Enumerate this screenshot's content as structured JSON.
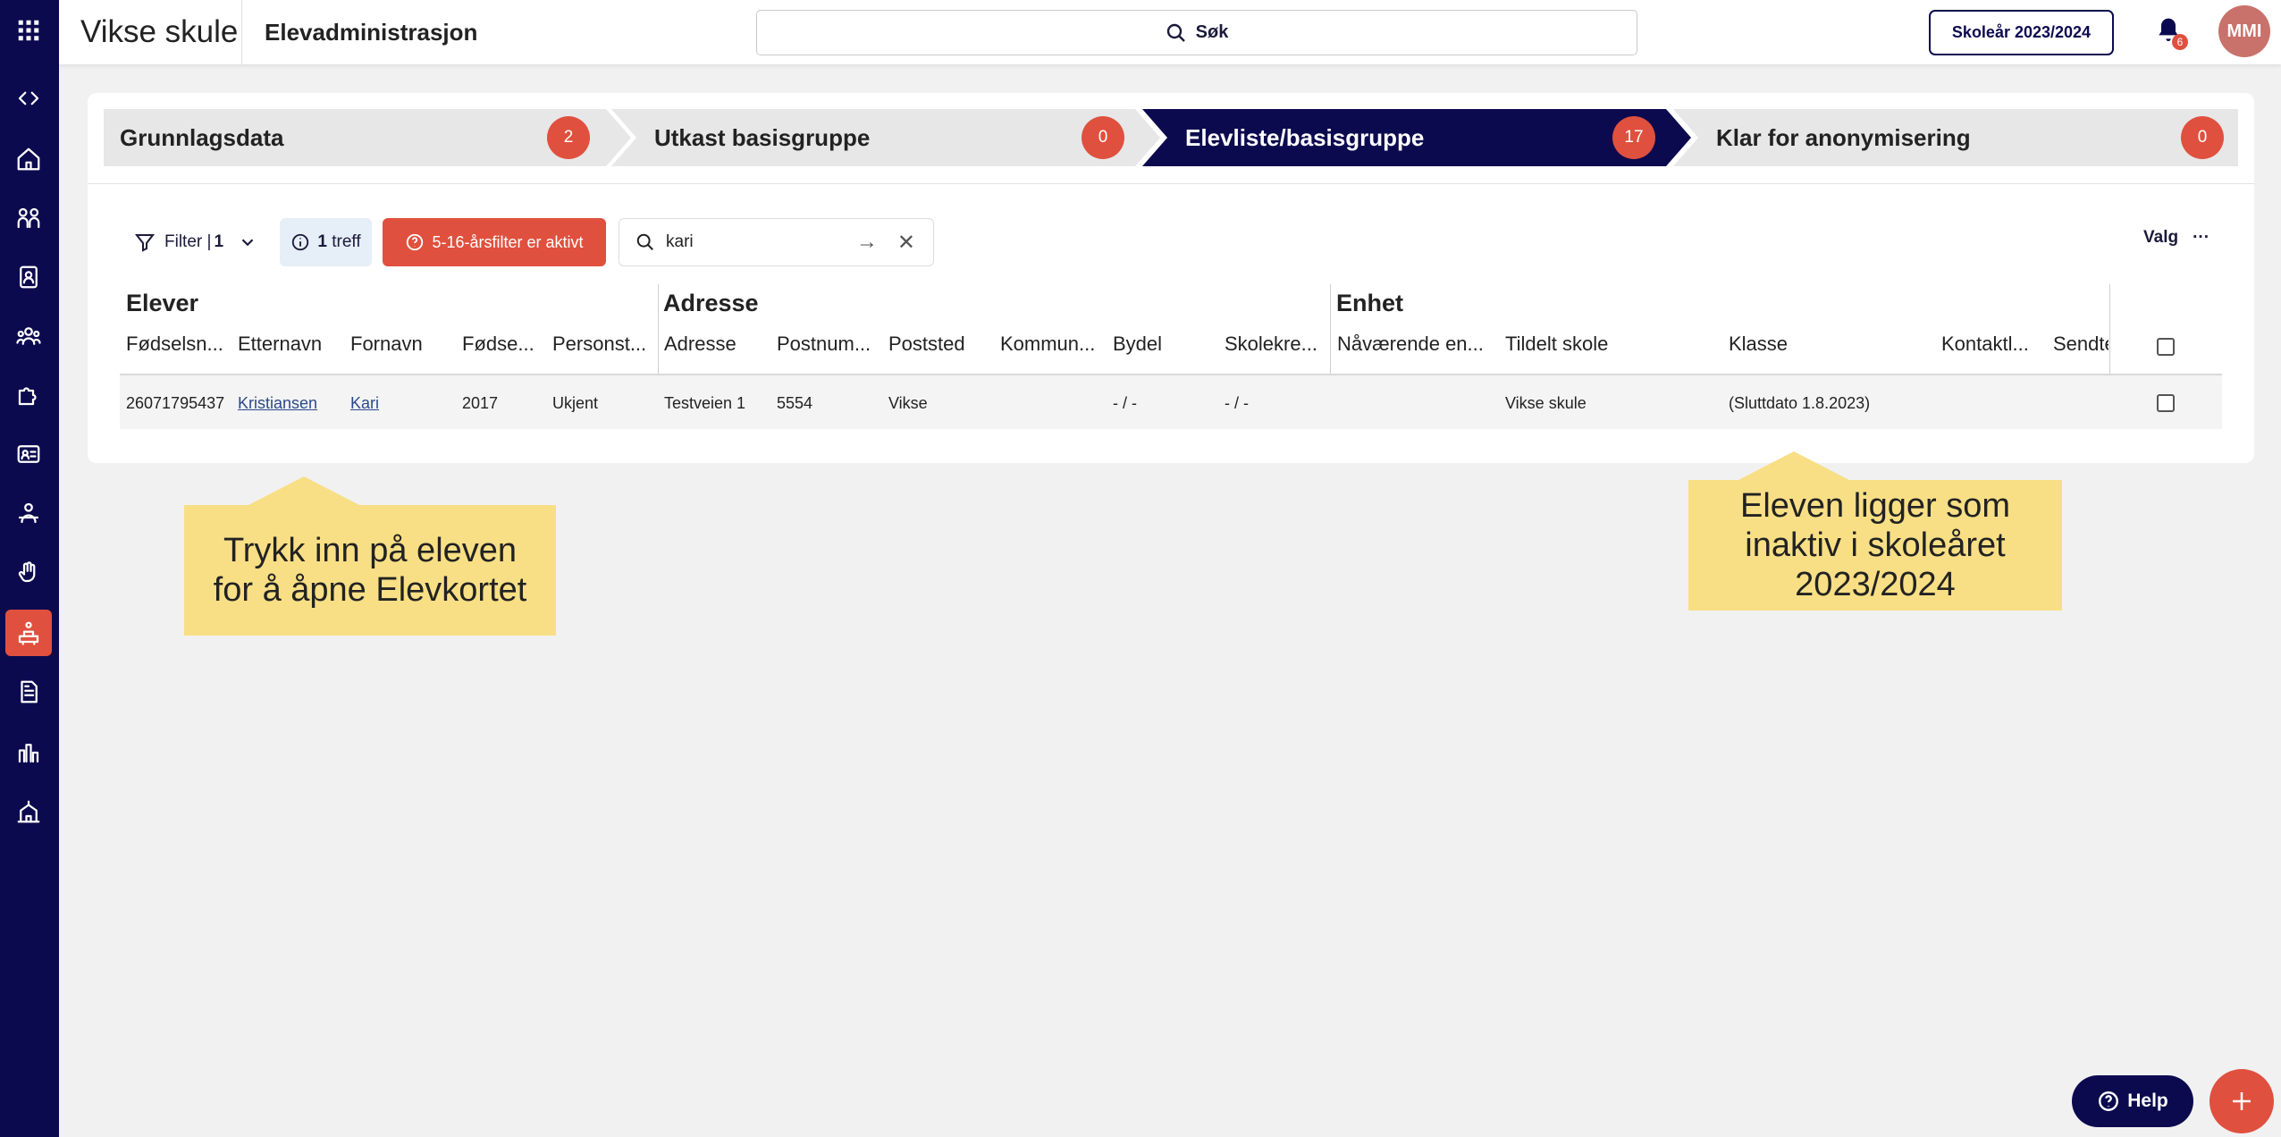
{
  "header": {
    "school_name": "Vikse skule",
    "app_title": "Elevadministrasjon",
    "search_label": "Søk",
    "year_button": "Skoleår 2023/2024",
    "notification_count": "6",
    "user_initials": "MMI"
  },
  "steps": [
    {
      "label": "Grunnlagsdata",
      "count": "2"
    },
    {
      "label": "Utkast basisgruppe",
      "count": "0"
    },
    {
      "label": "Elevliste/basisgruppe",
      "count": "17"
    },
    {
      "label": "Klar for anonymisering",
      "count": "0"
    }
  ],
  "toolbar": {
    "filter_label": "Filter |",
    "filter_count": "1",
    "hits_count": "1",
    "hits_label": "treff",
    "age_filter": "5-16-årsfilter er aktivt",
    "search_value": "kari",
    "valg_label": "Valg"
  },
  "table": {
    "groups": [
      "Elever",
      "Adresse",
      "Enhet"
    ],
    "columns": [
      "Fødselsn...",
      "Etternavn",
      "Fornavn",
      "Fødse...",
      "Personst...",
      "Adresse",
      "Postnum...",
      "Poststed",
      "Kommun...",
      "Bydel",
      "Skolekre...",
      "Nåværende en...",
      "Tildelt skole",
      "Klasse",
      "Kontaktl...",
      "Sendte"
    ],
    "rows": [
      {
        "fodselsnummer": "26071795437",
        "etternavn": "Kristiansen",
        "fornavn": "Kari",
        "fodselsar": "2017",
        "personstatus": "Ukjent",
        "adresse": "Testveien 1",
        "postnummer": "5554",
        "poststed": "Vikse",
        "kommune": "",
        "bydel": "- / -",
        "skolekrets": "- / -",
        "navaerende_enhet": "",
        "tildelt_skole": "Vikse skule",
        "klasse": "(Sluttdato 1.8.2023)",
        "kontaktlaerer": "",
        "sendte": ""
      }
    ]
  },
  "callouts": {
    "left_line1": "Trykk inn på eleven",
    "left_line2": "for å åpne Elevkortet",
    "right_line1": "Eleven ligger som",
    "right_line2": "inaktiv i skoleåret",
    "right_line3": "2023/2024"
  },
  "help_label": "Help",
  "colors": {
    "navy": "#0c0a4f",
    "accent": "#e0503e",
    "callout": "#f8df85"
  }
}
